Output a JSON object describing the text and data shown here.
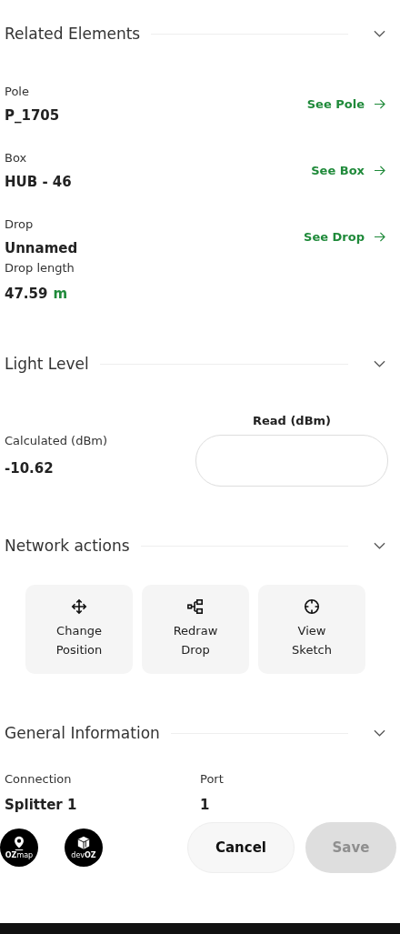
{
  "related": {
    "title": "Related Elements",
    "expanded": true,
    "items": [
      {
        "label": "Pole",
        "value": "P_1705",
        "link": "See Pole"
      },
      {
        "label": "Box",
        "value": "HUB - 46",
        "link": "See Box"
      },
      {
        "label": "Drop",
        "value": "Unnamed",
        "link": "See Drop"
      }
    ],
    "drop_length": {
      "label": "Drop length",
      "value": "47.59",
      "unit": "m"
    }
  },
  "light": {
    "title": "Light Level",
    "expanded": true,
    "calculated_label": "Calculated (dBm)",
    "calculated_value": "-10.62",
    "read_label": "Read (dBm)"
  },
  "actions": {
    "title": "Network actions",
    "expanded": true,
    "tiles": [
      {
        "kind": "move",
        "label": "Change Position"
      },
      {
        "kind": "nodes",
        "label": "Redraw Drop"
      },
      {
        "kind": "target",
        "label": "View Sketch"
      }
    ]
  },
  "general": {
    "title": "General Information",
    "expanded": true,
    "fields": [
      {
        "label": "Connection",
        "value": "Splitter 1"
      },
      {
        "label": "Port",
        "value": "1"
      }
    ]
  },
  "footer": {
    "logos": [
      {
        "kind": "pin",
        "text": "**OZ**map"
      },
      {
        "kind": "cube",
        "text": "dev**OZ**"
      }
    ],
    "buttons": [
      {
        "label": "Cancel",
        "disabled": false
      },
      {
        "label": "Save",
        "disabled": true
      }
    ]
  }
}
